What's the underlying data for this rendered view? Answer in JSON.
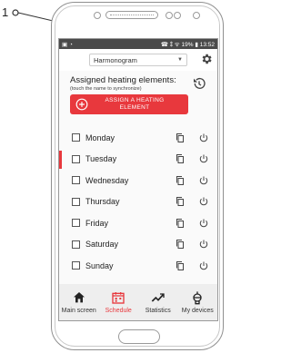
{
  "callout": {
    "number": "1"
  },
  "status_bar": {
    "right_text": "☎ ⁑ ᯤ 19% ▮ 13:52",
    "left_icons": "▣ ◔"
  },
  "top_bar": {
    "dropdown_value": "Harmonogram"
  },
  "assigned": {
    "title": "Assigned heating elements:",
    "hint": "(touch the name to synchronize)",
    "assign_button_line1": "ASSIGN A HEATING",
    "assign_button_line2": "ELEMENT"
  },
  "days": [
    {
      "label": "Monday",
      "selected": false
    },
    {
      "label": "Tuesday",
      "selected": true
    },
    {
      "label": "Wednesday",
      "selected": false
    },
    {
      "label": "Thursday",
      "selected": false
    },
    {
      "label": "Friday",
      "selected": false
    },
    {
      "label": "Saturday",
      "selected": false
    },
    {
      "label": "Sunday",
      "selected": false
    }
  ],
  "bottom_nav": [
    {
      "label": "Main screen",
      "icon": "home-icon",
      "active": false
    },
    {
      "label": "Schedule",
      "icon": "calendar-icon",
      "active": true
    },
    {
      "label": "Statistics",
      "icon": "chart-icon",
      "active": false
    },
    {
      "label": "My devices",
      "icon": "devices-icon",
      "active": false
    }
  ],
  "colors": {
    "accent": "#e8383d",
    "status_bar": "#4a4a4a",
    "nav_bg": "#eeeeee"
  }
}
